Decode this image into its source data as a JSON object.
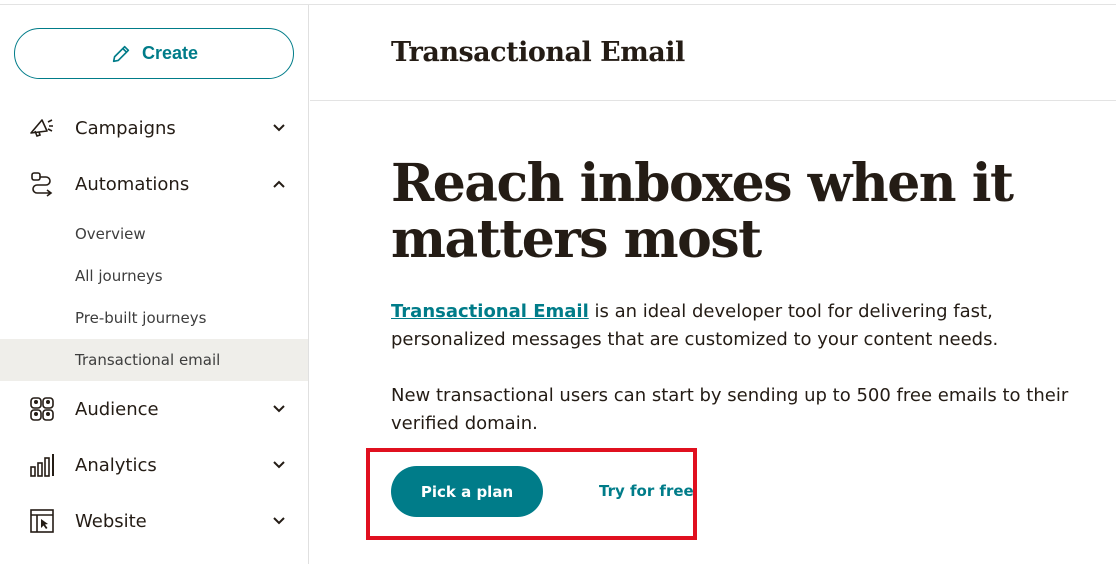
{
  "sidebar": {
    "create_label": "Create",
    "nav": [
      {
        "label": "Campaigns",
        "icon": "megaphone-icon",
        "expanded": false
      },
      {
        "label": "Automations",
        "icon": "automations-icon",
        "expanded": true
      },
      {
        "label": "Audience",
        "icon": "audience-icon",
        "expanded": false
      },
      {
        "label": "Analytics",
        "icon": "analytics-icon",
        "expanded": false
      },
      {
        "label": "Website",
        "icon": "website-icon",
        "expanded": false
      }
    ],
    "automations_sub": [
      {
        "label": "Overview",
        "active": false
      },
      {
        "label": "All journeys",
        "active": false
      },
      {
        "label": "Pre-built journeys",
        "active": false
      },
      {
        "label": "Transactional email",
        "active": true
      }
    ]
  },
  "header": {
    "title": "Transactional Email"
  },
  "main": {
    "hero_title": "Reach inboxes when it matters most",
    "para1_link": "Transactional Email",
    "para1_rest": " is an ideal developer tool for delivering fast, personalized messages that are customized to your content needs.",
    "para2": "New transactional users can start by sending up to 500 free emails to their verified domain.",
    "pick_plan_label": "Pick a plan",
    "try_free_label": "Try for free"
  },
  "colors": {
    "accent": "#007c89",
    "highlight": "#e0101f",
    "active_bg": "#efeeea"
  }
}
